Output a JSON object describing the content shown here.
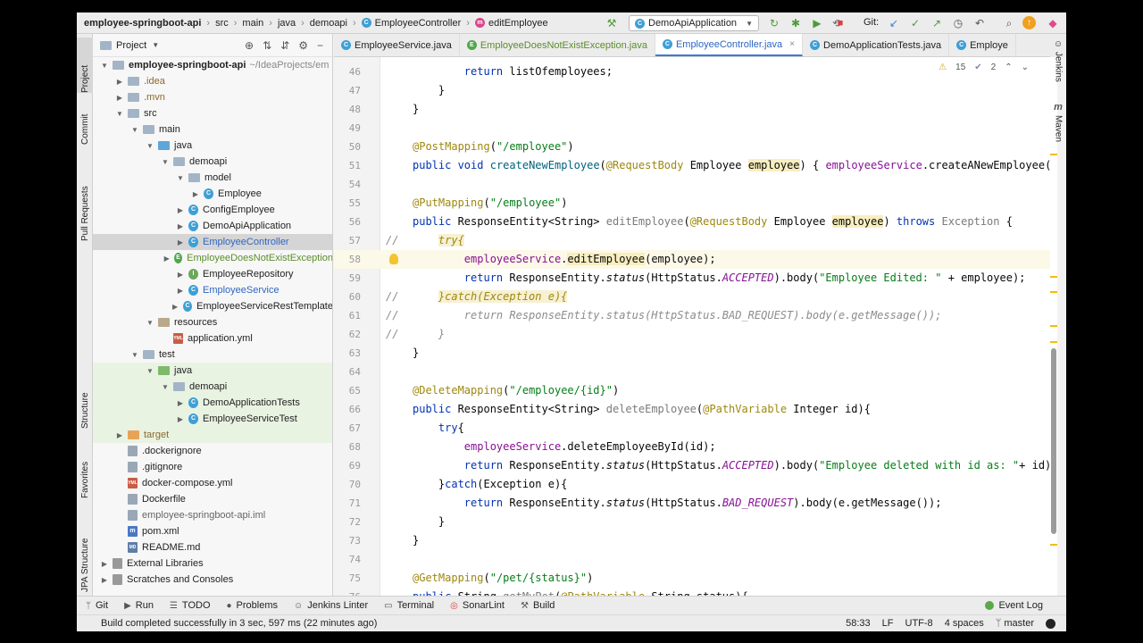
{
  "breadcrumbs": [
    "employee-springboot-api",
    "src",
    "main",
    "java",
    "demoapi",
    "EmployeeController",
    "editEmployee"
  ],
  "run_config": "DemoApiApplication",
  "git_label": "Git:",
  "project_panel": {
    "title": "Project",
    "tree": [
      {
        "label": "employee-springboot-api",
        "hint": "~/IdeaProjects/em",
        "indent": 0,
        "arrow": "open",
        "icon": "folder",
        "style": "bold"
      },
      {
        "label": ".idea",
        "indent": 1,
        "arrow": "closed",
        "icon": "folder",
        "style": "brown"
      },
      {
        "label": ".mvn",
        "indent": 1,
        "arrow": "closed",
        "icon": "folder",
        "style": "brown"
      },
      {
        "label": "src",
        "indent": 1,
        "arrow": "open",
        "icon": "folder"
      },
      {
        "label": "main",
        "indent": 2,
        "arrow": "open",
        "icon": "folder"
      },
      {
        "label": "java",
        "indent": 3,
        "arrow": "open",
        "icon": "folder-blue"
      },
      {
        "label": "demoapi",
        "indent": 4,
        "arrow": "open",
        "icon": "folder"
      },
      {
        "label": "model",
        "indent": 5,
        "arrow": "open",
        "icon": "folder"
      },
      {
        "label": "Employee",
        "indent": 6,
        "arrow": "closed",
        "icon": "class"
      },
      {
        "label": "ConfigEmployee",
        "indent": 5,
        "arrow": "closed",
        "icon": "class"
      },
      {
        "label": "DemoApiApplication",
        "indent": 5,
        "arrow": "closed",
        "icon": "class"
      },
      {
        "label": "EmployeeController",
        "indent": 5,
        "arrow": "closed",
        "icon": "class",
        "style": "blue",
        "selected": true
      },
      {
        "label": "EmployeeDoesNotExistException",
        "indent": 5,
        "arrow": "closed",
        "icon": "exception",
        "style": "green"
      },
      {
        "label": "EmployeeRepository",
        "indent": 5,
        "arrow": "closed",
        "icon": "interface"
      },
      {
        "label": "EmployeeService",
        "indent": 5,
        "arrow": "closed",
        "icon": "class",
        "style": "blue"
      },
      {
        "label": "EmployeeServiceRestTemplate",
        "indent": 5,
        "arrow": "closed",
        "icon": "class"
      },
      {
        "label": "resources",
        "indent": 3,
        "arrow": "open",
        "icon": "folder-res"
      },
      {
        "label": "application.yml",
        "indent": 4,
        "arrow": "none",
        "icon": "yml"
      },
      {
        "label": "test",
        "indent": 2,
        "arrow": "open",
        "icon": "folder"
      },
      {
        "label": "java",
        "indent": 3,
        "arrow": "open",
        "icon": "folder-green",
        "green": true
      },
      {
        "label": "demoapi",
        "indent": 4,
        "arrow": "open",
        "icon": "folder",
        "green": true
      },
      {
        "label": "DemoApplicationTests",
        "indent": 5,
        "arrow": "closed",
        "icon": "class",
        "green": true
      },
      {
        "label": "EmployeeServiceTest",
        "indent": 5,
        "arrow": "closed",
        "icon": "class",
        "green": true
      },
      {
        "label": "target",
        "indent": 1,
        "arrow": "closed",
        "icon": "folder-orange",
        "style": "brown",
        "green": true
      },
      {
        "label": ".dockerignore",
        "indent": 1,
        "arrow": "none",
        "icon": "doc"
      },
      {
        "label": ".gitignore",
        "indent": 1,
        "arrow": "none",
        "icon": "doc"
      },
      {
        "label": "docker-compose.yml",
        "indent": 1,
        "arrow": "none",
        "icon": "yml"
      },
      {
        "label": "Dockerfile",
        "indent": 1,
        "arrow": "none",
        "icon": "doc"
      },
      {
        "label": "employee-springboot-api.iml",
        "indent": 1,
        "arrow": "none",
        "icon": "doc",
        "style": "muted"
      },
      {
        "label": "pom.xml",
        "indent": 1,
        "arrow": "none",
        "icon": "maven"
      },
      {
        "label": "README.md",
        "indent": 1,
        "arrow": "none",
        "icon": "md"
      },
      {
        "label": "External Libraries",
        "indent": 0,
        "arrow": "closed",
        "icon": "lib"
      },
      {
        "label": "Scratches and Consoles",
        "indent": 0,
        "arrow": "closed",
        "icon": "scratch"
      }
    ]
  },
  "left_tabs": [
    "Project",
    "Commit",
    "Pull Requests",
    "Structure",
    "Favorites",
    "JPA Structure"
  ],
  "right_tabs": [
    "Jenkins",
    "Maven"
  ],
  "editor_tabs": [
    {
      "label": "EmployeeService.java",
      "icon": "C"
    },
    {
      "label": "EmployeeDoesNotExistException.java",
      "icon": "E"
    },
    {
      "label": "EmployeeController.java",
      "icon": "C",
      "active": true
    },
    {
      "label": "DemoApplicationTests.java",
      "icon": "C"
    },
    {
      "label": "Employe",
      "icon": "C"
    }
  ],
  "inspections": {
    "warnings": "15",
    "weak": "2"
  },
  "code_lines": [
    {
      "n": "46",
      "html": "        <span class='t-kw'>return</span> listOfemployees;"
    },
    {
      "n": "47",
      "html": "    }"
    },
    {
      "n": "48",
      "html": "}"
    },
    {
      "n": "49",
      "html": ""
    },
    {
      "n": "50",
      "html": "<span class='t-ann'>@PostMapping</span>(<span class='t-str'>\"/employee\"</span>)"
    },
    {
      "n": "51",
      "html": "<span class='t-kw'>public void</span> <span class='t-fn'>createNewEmployee</span>(<span class='t-ann'>@RequestBody</span> Employee <span class='t-hl'>employee</span>) { <span class='t-field'>employeeService</span>.createANewEmployee("
    },
    {
      "n": "54",
      "html": ""
    },
    {
      "n": "55",
      "html": "<span class='t-ann'>@PutMapping</span>(<span class='t-str'>\"/employee\"</span>)"
    },
    {
      "n": "56",
      "html": "<span class='t-kw'>public</span> ResponseEntity&lt;String&gt; <span class='t-unused'>editEmployee</span>(<span class='t-ann'>@RequestBody</span> Employee <span class='t-hl'>employee</span>) <span class='t-kw'>throws</span> <span class='t-unused'>Exception</span> {"
    },
    {
      "n": "57",
      "comment": "//",
      "html": "    <span class='t-try'>try{</span>"
    },
    {
      "n": "58",
      "html": "        <span class='t-field'>employeeService</span>.<span class='t-hl'>editEmployee</span>(employee);",
      "highlight": true,
      "bulb": true
    },
    {
      "n": "59",
      "html": "        <span class='t-kw'>return</span> ResponseEntity.<span class='t-static'>status</span>(HttpStatus.<span class='t-const'>ACCEPTED</span>).body(<span class='t-str'>\"Employee Edited: \"</span> + employee);"
    },
    {
      "n": "60",
      "comment": "//",
      "html": "    <span class='t-try'>}catch(Exception e){</span>"
    },
    {
      "n": "61",
      "comment": "//",
      "html": "        <span class='t-gray-it'>return ResponseEntity.status(HttpStatus.BAD_REQUEST).body(e.getMessage());</span>"
    },
    {
      "n": "62",
      "comment": "//",
      "html": "    <span class='t-gray-it'>}</span>"
    },
    {
      "n": "63",
      "html": "}"
    },
    {
      "n": "64",
      "html": ""
    },
    {
      "n": "65",
      "html": "<span class='t-ann'>@DeleteMapping</span>(<span class='t-str'>\"/employee/{id}\"</span>)"
    },
    {
      "n": "66",
      "html": "<span class='t-kw'>public</span> ResponseEntity&lt;String&gt; <span class='t-unused'>deleteEmployee</span>(<span class='t-ann'>@PathVariable</span> Integer id){"
    },
    {
      "n": "67",
      "html": "    <span class='t-kw'>try</span>{"
    },
    {
      "n": "68",
      "html": "        <span class='t-field'>employeeService</span>.deleteEmployeeById(id);"
    },
    {
      "n": "69",
      "html": "        <span class='t-kw'>return</span> ResponseEntity.<span class='t-static'>status</span>(HttpStatus.<span class='t-const'>ACCEPTED</span>).body(<span class='t-str'>\"Employee deleted with id as: \"</span>+ id);"
    },
    {
      "n": "70",
      "html": "    }<span class='t-kw'>catch</span>(Exception e){"
    },
    {
      "n": "71",
      "html": "        <span class='t-kw'>return</span> ResponseEntity.<span class='t-static'>status</span>(HttpStatus.<span class='t-const'>BAD_REQUEST</span>).body(e.getMessage());"
    },
    {
      "n": "72",
      "html": "    }"
    },
    {
      "n": "73",
      "html": "}"
    },
    {
      "n": "74",
      "html": ""
    },
    {
      "n": "75",
      "html": "<span class='t-ann'>@GetMapping</span>(<span class='t-str'>\"/pet/{status}\"</span>)"
    },
    {
      "n": "76",
      "html": "<span class='t-kw'>public</span> String <span class='t-unused'>getMyPet</span>(<span class='t-ann'>@PathVariable</span> String status){"
    }
  ],
  "bottom_tools": [
    {
      "label": "Git",
      "icon": "git-icon"
    },
    {
      "label": "Run",
      "icon": "run-icon"
    },
    {
      "label": "TODO",
      "icon": "todo-icon"
    },
    {
      "label": "Problems",
      "icon": "problems-icon"
    },
    {
      "label": "Jenkins Linter",
      "icon": "jenkins-icon"
    },
    {
      "label": "Terminal",
      "icon": "terminal-icon"
    },
    {
      "label": "SonarLint",
      "icon": "sonarlint-icon"
    },
    {
      "label": "Build",
      "icon": "build-icon"
    }
  ],
  "event_log": "Event Log",
  "status": {
    "message": "Build completed successfully in 3 sec, 597 ms (22 minutes ago)",
    "position": "58:33",
    "line_sep": "LF",
    "encoding": "UTF-8",
    "indent": "4 spaces",
    "branch": "master"
  }
}
